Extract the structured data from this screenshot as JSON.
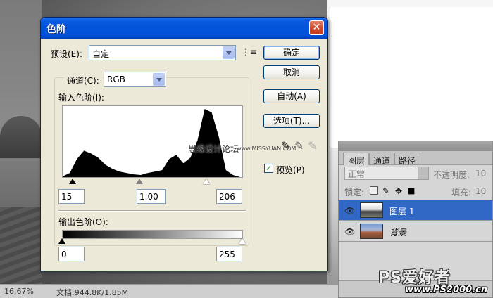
{
  "status_bar": {
    "zoom": "16.67%",
    "doc_info": "文档:944.8K/1.85M"
  },
  "dialog": {
    "title": "色阶",
    "close_glyph": "✕",
    "preset_label": "预设(E):",
    "preset_value": "自定",
    "preset_menu_glyph": "⋮≡",
    "channel_label": "通道(C):",
    "channel_value": "RGB",
    "input_levels_label": "输入色阶(I):",
    "input_black": "15",
    "input_gamma": "1.00",
    "input_white": "206",
    "output_levels_label": "输出色阶(O):",
    "output_black": "0",
    "output_white": "255",
    "buttons": {
      "ok": "确定",
      "cancel": "取消",
      "auto": "自动(A)",
      "options": "选项(T)..."
    },
    "preview_label": "预览(P)",
    "preview_checked": "✓",
    "eyedropper_glyph": "✎"
  },
  "layers_panel": {
    "tabs": [
      "图层",
      "通道",
      "路径"
    ],
    "blend_mode": "正常",
    "opacity_label": "不透明度:",
    "opacity_value": "10",
    "lock_label": "锁定:",
    "fill_label": "填充:",
    "fill_value": "10",
    "eye_glyph": "👁",
    "layers": [
      {
        "name": "图层 1",
        "selected": true
      },
      {
        "name": "背景",
        "selected": false
      }
    ]
  },
  "watermarks": {
    "top": "思缘设计论坛",
    "top_url": "www.MISSYUAN.COM",
    "logo": "PS爱好者",
    "url": "www.PS2000.cn"
  },
  "colors": {
    "title_blue": "#0455da",
    "selected_layer": "#3168c5",
    "dialog_bg": "#ece9d8"
  },
  "chart_data": {
    "type": "area",
    "title": "",
    "x": [
      0,
      10,
      20,
      30,
      40,
      50,
      60,
      70,
      80,
      90,
      100,
      110,
      120,
      130,
      140,
      150,
      160,
      170,
      180,
      190,
      200,
      210,
      220,
      230,
      240,
      250,
      255
    ],
    "values": [
      3,
      8,
      28,
      40,
      36,
      30,
      20,
      14,
      10,
      8,
      6,
      5,
      8,
      10,
      12,
      28,
      34,
      22,
      30,
      55,
      100,
      95,
      60,
      12,
      5,
      2,
      0
    ],
    "xlim": [
      0,
      255
    ],
    "ylim": [
      0,
      100
    ]
  }
}
